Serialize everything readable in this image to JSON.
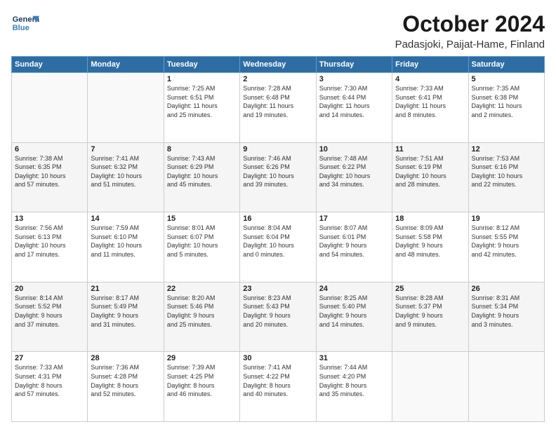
{
  "header": {
    "logo_line1": "General",
    "logo_line2": "Blue",
    "main_title": "October 2024",
    "subtitle": "Padasjoki, Paijat-Hame, Finland"
  },
  "days_of_week": [
    "Sunday",
    "Monday",
    "Tuesday",
    "Wednesday",
    "Thursday",
    "Friday",
    "Saturday"
  ],
  "weeks": [
    [
      {
        "day": "",
        "detail": ""
      },
      {
        "day": "",
        "detail": ""
      },
      {
        "day": "1",
        "detail": "Sunrise: 7:25 AM\nSunset: 6:51 PM\nDaylight: 11 hours\nand 25 minutes."
      },
      {
        "day": "2",
        "detail": "Sunrise: 7:28 AM\nSunset: 6:48 PM\nDaylight: 11 hours\nand 19 minutes."
      },
      {
        "day": "3",
        "detail": "Sunrise: 7:30 AM\nSunset: 6:44 PM\nDaylight: 11 hours\nand 14 minutes."
      },
      {
        "day": "4",
        "detail": "Sunrise: 7:33 AM\nSunset: 6:41 PM\nDaylight: 11 hours\nand 8 minutes."
      },
      {
        "day": "5",
        "detail": "Sunrise: 7:35 AM\nSunset: 6:38 PM\nDaylight: 11 hours\nand 2 minutes."
      }
    ],
    [
      {
        "day": "6",
        "detail": "Sunrise: 7:38 AM\nSunset: 6:35 PM\nDaylight: 10 hours\nand 57 minutes."
      },
      {
        "day": "7",
        "detail": "Sunrise: 7:41 AM\nSunset: 6:32 PM\nDaylight: 10 hours\nand 51 minutes."
      },
      {
        "day": "8",
        "detail": "Sunrise: 7:43 AM\nSunset: 6:29 PM\nDaylight: 10 hours\nand 45 minutes."
      },
      {
        "day": "9",
        "detail": "Sunrise: 7:46 AM\nSunset: 6:26 PM\nDaylight: 10 hours\nand 39 minutes."
      },
      {
        "day": "10",
        "detail": "Sunrise: 7:48 AM\nSunset: 6:22 PM\nDaylight: 10 hours\nand 34 minutes."
      },
      {
        "day": "11",
        "detail": "Sunrise: 7:51 AM\nSunset: 6:19 PM\nDaylight: 10 hours\nand 28 minutes."
      },
      {
        "day": "12",
        "detail": "Sunrise: 7:53 AM\nSunset: 6:16 PM\nDaylight: 10 hours\nand 22 minutes."
      }
    ],
    [
      {
        "day": "13",
        "detail": "Sunrise: 7:56 AM\nSunset: 6:13 PM\nDaylight: 10 hours\nand 17 minutes."
      },
      {
        "day": "14",
        "detail": "Sunrise: 7:59 AM\nSunset: 6:10 PM\nDaylight: 10 hours\nand 11 minutes."
      },
      {
        "day": "15",
        "detail": "Sunrise: 8:01 AM\nSunset: 6:07 PM\nDaylight: 10 hours\nand 5 minutes."
      },
      {
        "day": "16",
        "detail": "Sunrise: 8:04 AM\nSunset: 6:04 PM\nDaylight: 10 hours\nand 0 minutes."
      },
      {
        "day": "17",
        "detail": "Sunrise: 8:07 AM\nSunset: 6:01 PM\nDaylight: 9 hours\nand 54 minutes."
      },
      {
        "day": "18",
        "detail": "Sunrise: 8:09 AM\nSunset: 5:58 PM\nDaylight: 9 hours\nand 48 minutes."
      },
      {
        "day": "19",
        "detail": "Sunrise: 8:12 AM\nSunset: 5:55 PM\nDaylight: 9 hours\nand 42 minutes."
      }
    ],
    [
      {
        "day": "20",
        "detail": "Sunrise: 8:14 AM\nSunset: 5:52 PM\nDaylight: 9 hours\nand 37 minutes."
      },
      {
        "day": "21",
        "detail": "Sunrise: 8:17 AM\nSunset: 5:49 PM\nDaylight: 9 hours\nand 31 minutes."
      },
      {
        "day": "22",
        "detail": "Sunrise: 8:20 AM\nSunset: 5:46 PM\nDaylight: 9 hours\nand 25 minutes."
      },
      {
        "day": "23",
        "detail": "Sunrise: 8:23 AM\nSunset: 5:43 PM\nDaylight: 9 hours\nand 20 minutes."
      },
      {
        "day": "24",
        "detail": "Sunrise: 8:25 AM\nSunset: 5:40 PM\nDaylight: 9 hours\nand 14 minutes."
      },
      {
        "day": "25",
        "detail": "Sunrise: 8:28 AM\nSunset: 5:37 PM\nDaylight: 9 hours\nand 9 minutes."
      },
      {
        "day": "26",
        "detail": "Sunrise: 8:31 AM\nSunset: 5:34 PM\nDaylight: 9 hours\nand 3 minutes."
      }
    ],
    [
      {
        "day": "27",
        "detail": "Sunrise: 7:33 AM\nSunset: 4:31 PM\nDaylight: 8 hours\nand 57 minutes."
      },
      {
        "day": "28",
        "detail": "Sunrise: 7:36 AM\nSunset: 4:28 PM\nDaylight: 8 hours\nand 52 minutes."
      },
      {
        "day": "29",
        "detail": "Sunrise: 7:39 AM\nSunset: 4:25 PM\nDaylight: 8 hours\nand 46 minutes."
      },
      {
        "day": "30",
        "detail": "Sunrise: 7:41 AM\nSunset: 4:22 PM\nDaylight: 8 hours\nand 40 minutes."
      },
      {
        "day": "31",
        "detail": "Sunrise: 7:44 AM\nSunset: 4:20 PM\nDaylight: 8 hours\nand 35 minutes."
      },
      {
        "day": "",
        "detail": ""
      },
      {
        "day": "",
        "detail": ""
      }
    ]
  ]
}
